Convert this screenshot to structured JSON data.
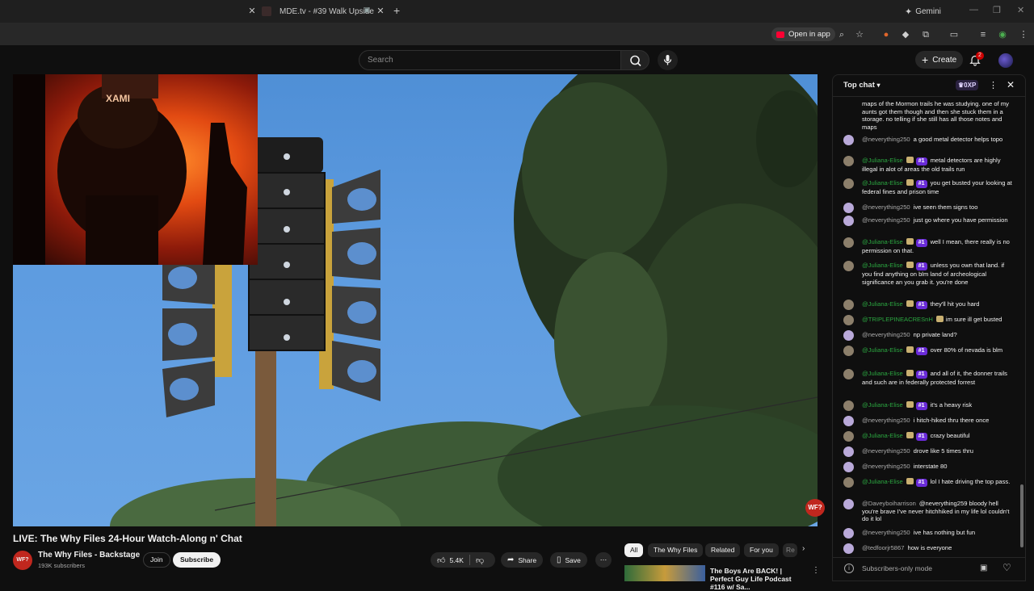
{
  "browser": {
    "active_tab_title": "MDE.tv - #39 Walk Upside",
    "gemini_label": "Gemini",
    "open_in_app_label": "Open in app"
  },
  "masthead": {
    "search_placeholder": "Search",
    "create_label": "Create",
    "notification_count": "2"
  },
  "video": {
    "title": "LIVE: The Why Files 24-Hour Watch-Along n' Chat",
    "watermark_text": "WF?"
  },
  "channel": {
    "avatar_text": "WF?",
    "name": "The Why Files - Backstage",
    "subscribers": "193K subscribers",
    "join_label": "Join",
    "subscribe_label": "Subscribe"
  },
  "actions": {
    "likes": "5.4K",
    "share_label": "Share",
    "save_label": "Save"
  },
  "chips": [
    "All",
    "The Why Files",
    "Related",
    "For you",
    "Re"
  ],
  "recommendation": {
    "title": "The Boys Are BACK! | Perfect Guy Life Podcast #116 w/ Sa..."
  },
  "chat": {
    "header_label": "Top chat",
    "xp_badge": "0XP",
    "footer_mode": "Subscribers-only mode",
    "messages": [
      {
        "author": "",
        "rank": "",
        "text": "maps of the Mormon trails he was studying. one of my aunts got them though and then she stuck them in a storage. no telling if she still has all those notes and maps",
        "member": false
      },
      {
        "author": "@neverything250",
        "rank": "",
        "text": "a good metal detector helps topo",
        "member": false
      },
      {
        "author": "@Juliana-Elise",
        "rank": "#1",
        "text": "metal detectors are highly illegal in alot of areas the old trails run",
        "member": true
      },
      {
        "author": "@Juliana-Elise",
        "rank": "#1",
        "text": "you get busted your looking at federal fines and prison time",
        "member": true
      },
      {
        "author": "@neverything250",
        "rank": "",
        "text": "ive seen them signs too",
        "member": false
      },
      {
        "author": "@neverything250",
        "rank": "",
        "text": "just go where you have permission",
        "member": false
      },
      {
        "author": "@Juliana-Elise",
        "rank": "#1",
        "text": "well I mean, there really is no permission on that.",
        "member": true
      },
      {
        "author": "@Juliana-Elise",
        "rank": "#1",
        "text": "unless you own that land. if you find anything on blm land of archeological significance an you grab it. you're done",
        "member": true
      },
      {
        "author": "@Juliana-Elise",
        "rank": "#1",
        "text": "they'll hit you hard",
        "member": true
      },
      {
        "author": "@TRIPLEPINEACRESnH",
        "rank": "",
        "text": "im sure ill get busted",
        "member": true
      },
      {
        "author": "@neverything250",
        "rank": "",
        "text": "np private land?",
        "member": false
      },
      {
        "author": "@Juliana-Elise",
        "rank": "#1",
        "text": "over 80% of nevada is blm",
        "member": true
      },
      {
        "author": "@Juliana-Elise",
        "rank": "#1",
        "text": "and all of it, the donner trails and such are in federally protected forrest",
        "member": true
      },
      {
        "author": "@Juliana-Elise",
        "rank": "#1",
        "text": "it's a heavy risk",
        "member": true
      },
      {
        "author": "@neverything250",
        "rank": "",
        "text": "i hitch-hiked thru there once",
        "member": false
      },
      {
        "author": "@Juliana-Elise",
        "rank": "#1",
        "text": "crazy beautiful",
        "member": true
      },
      {
        "author": "@neverything250",
        "rank": "",
        "text": "drove like 5 times thru",
        "member": false
      },
      {
        "author": "@neverything250",
        "rank": "",
        "text": "interstate 80",
        "member": false
      },
      {
        "author": "@Juliana-Elise",
        "rank": "#1",
        "text": "lol I hate driving the top pass.",
        "member": true
      },
      {
        "author": "@Daveyboiharrison",
        "rank": "",
        "text": "@neverything259 bloody hell you're brave I've never hitchhiked in my life lol couldn't do it lol",
        "member": false
      },
      {
        "author": "@neverything250",
        "rank": "",
        "text": "ive has nothing but fun",
        "member": false
      },
      {
        "author": "@tedfoorjr5867",
        "rank": "",
        "text": "how is everyone",
        "member": false
      }
    ]
  },
  "colors": {
    "brand_red": "#ff0033",
    "member_green": "#2ba640",
    "rank_purple": "#6a2bd8"
  }
}
